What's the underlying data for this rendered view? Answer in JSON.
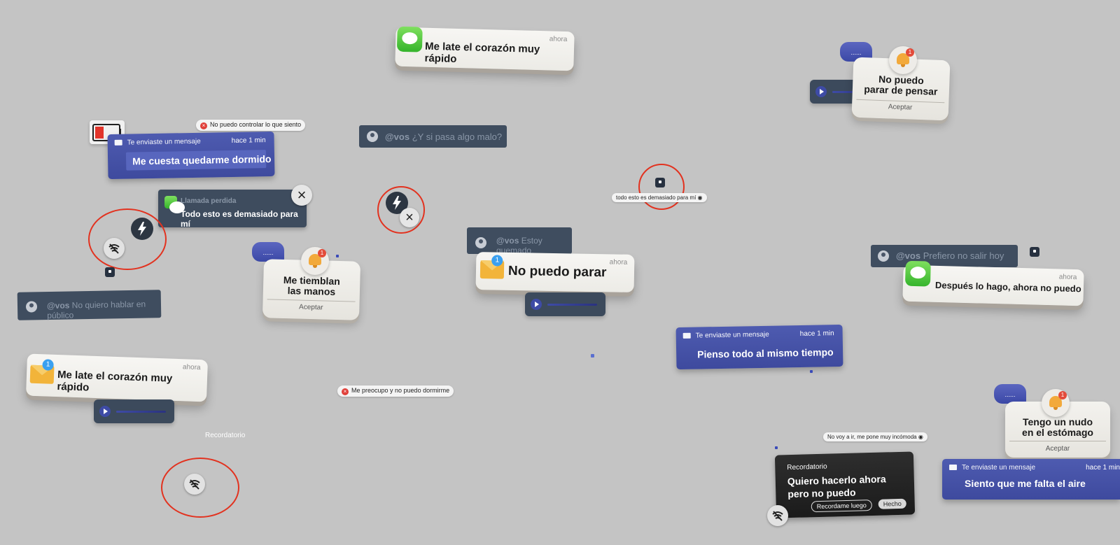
{
  "cards": {
    "c1": {
      "time": "ahora",
      "text": "Me late el corazón muy rápido"
    },
    "c2": {
      "time": "ahora",
      "text": "No puedo parar"
    },
    "c3": {
      "time": "ahora",
      "text": "Después lo hago, ahora no puedo"
    },
    "c4": {
      "time": "ahora",
      "text": "Me late el corazón muy rápido"
    }
  },
  "badges": {
    "mail1": "1",
    "mail2": "1",
    "bell": "1"
  },
  "blue": {
    "b1": {
      "header": "Te enviaste un mensaje",
      "time": "hace 1 min",
      "text": "Me cuesta quedarme dormido"
    },
    "b2": {
      "header": "Te enviaste un mensaje",
      "time": "hace 1 min",
      "text": "Pienso todo al mismo tiempo"
    },
    "b3": {
      "header": "Te enviaste un mensaje",
      "time": "hace 1 min",
      "text": "Siento que me falta el aire"
    }
  },
  "missed": {
    "label": "Llamada perdida",
    "text": "Todo esto es demasiado para mí"
  },
  "mentions": {
    "handle": "@vos",
    "m1": "¿Y si pasa algo malo?",
    "m2": "Estoy quemado",
    "m3": "Prefiero no salir hoy",
    "m4": "No quiero hablar en público"
  },
  "pills": {
    "p1": "No puedo controlar lo que siento",
    "p2": "todo esto es demasiado para mí",
    "p3": "Me preocupo y no puedo dormirme",
    "p4": "No voy a ir, me pone muy incómoda"
  },
  "alerts": {
    "a1": {
      "line1": "No puedo",
      "line2": "parar de pensar",
      "button": "Aceptar",
      "bubble": "......"
    },
    "a2": {
      "line1": "Me tiemblan",
      "line2": "las manos",
      "button": "Aceptar",
      "bubble": "......"
    },
    "a3": {
      "line1": "Tengo un nudo",
      "line2": "en el estómago",
      "button": "Aceptar",
      "bubble": "......"
    }
  },
  "reminder": {
    "floating_label": "Recordatorio",
    "label": "Recordatorio",
    "line1": "Quiero hacerlo ahora",
    "line2": "pero no puedo",
    "later": "Recordame luego",
    "done": "Hecho"
  },
  "colors": {
    "background": "#c4c4c4",
    "notif_blue": "#4552a6",
    "slate": "#3f4d5f",
    "ring_red": "#e2321f"
  }
}
